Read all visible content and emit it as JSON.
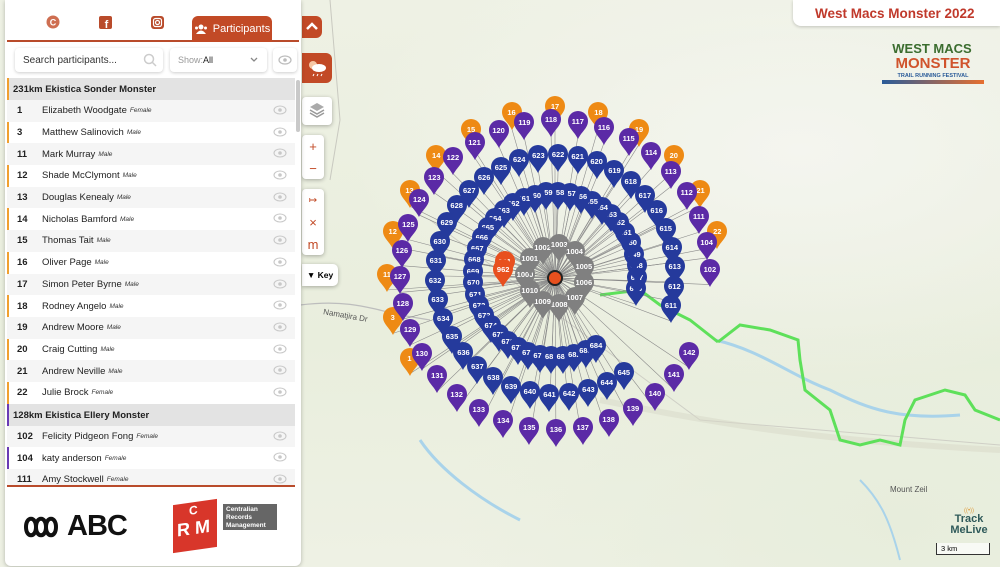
{
  "title": "West Macs Monster 2022",
  "event_logo": {
    "line1": "WEST MACS",
    "line2": "MONSTER",
    "line3": "TRAIL RUNNING FESTIVAL"
  },
  "tabs": {
    "icons": [
      "copyright-icon",
      "facebook-icon",
      "instagram-icon"
    ],
    "active_label": "Participants"
  },
  "filters": {
    "search_placeholder": "Search participants...",
    "show_label": "Show:",
    "show_value": "All"
  },
  "groups": [
    {
      "name": "231km Ekistica Sonder Monster",
      "color": "#f0a030",
      "participants": [
        {
          "num": "1",
          "name": "Elizabeth Woodgate",
          "gender": "Female"
        },
        {
          "num": "3",
          "name": "Matthew Salinovich",
          "gender": "Male"
        },
        {
          "num": "11",
          "name": "Mark Murray",
          "gender": "Male"
        },
        {
          "num": "12",
          "name": "Shade McClymont",
          "gender": "Male"
        },
        {
          "num": "13",
          "name": "Douglas Kenealy",
          "gender": "Male"
        },
        {
          "num": "14",
          "name": "Nicholas Bamford",
          "gender": "Male"
        },
        {
          "num": "15",
          "name": "Thomas Tait",
          "gender": "Male"
        },
        {
          "num": "16",
          "name": "Oliver Page",
          "gender": "Male"
        },
        {
          "num": "17",
          "name": "Simon Peter Byrne",
          "gender": "Male"
        },
        {
          "num": "18",
          "name": "Rodney Angelo",
          "gender": "Male"
        },
        {
          "num": "19",
          "name": "Andrew Moore",
          "gender": "Male"
        },
        {
          "num": "20",
          "name": "Craig Cutting",
          "gender": "Male"
        },
        {
          "num": "21",
          "name": "Andrew Neville",
          "gender": "Male"
        },
        {
          "num": "22",
          "name": "Julie Brock",
          "gender": "Female"
        }
      ]
    },
    {
      "name": "128km Ekistica Ellery Monster",
      "color": "#6a3bb5",
      "participants": [
        {
          "num": "102",
          "name": "Felicity Pidgeon Fong",
          "gender": "Female"
        },
        {
          "num": "104",
          "name": "katy anderson",
          "gender": "Female"
        },
        {
          "num": "111",
          "name": "Amy Stockwell",
          "gender": "Female"
        }
      ]
    }
  ],
  "sponsors": {
    "abc": "ABC",
    "crm": [
      "Centralian",
      "Records",
      "Management"
    ],
    "crm_letters": [
      "C",
      "R",
      "M"
    ]
  },
  "controls": {
    "collapse": "chevron-up",
    "zoom_in": "+",
    "zoom_out": "−",
    "measure": "↦",
    "clear": "×",
    "units": "m",
    "key_label": "▼ Key"
  },
  "map": {
    "labels": {
      "road": "Namatjira Dr",
      "mountain": "Mount Zeil"
    },
    "scale": "3 km",
    "brand": [
      "Track",
      "MeLive"
    ],
    "colors": {
      "orange": "#ee8a14",
      "purple": "#5b2aa6",
      "blue": "#253a9c",
      "grey": "#808080",
      "red": "#e8501e",
      "route": "#5ee05a"
    },
    "markers": {
      "orange": [
        "1",
        "3",
        "11",
        "12",
        "13",
        "14",
        "15",
        "16",
        "17",
        "18",
        "19",
        "20",
        "21",
        "22"
      ],
      "purple": [
        "102",
        "104",
        "111",
        "112",
        "113",
        "114",
        "115",
        "116",
        "117",
        "118",
        "119",
        "120",
        "121",
        "122",
        "123",
        "124",
        "125",
        "126",
        "127",
        "128",
        "129",
        "130",
        "131",
        "132",
        "133",
        "134",
        "135",
        "136",
        "137",
        "138",
        "139",
        "140",
        "141",
        "142"
      ],
      "blue_outer": [
        "611",
        "612",
        "613",
        "614",
        "615",
        "616",
        "617",
        "618",
        "619",
        "620",
        "621",
        "622",
        "623",
        "624",
        "625",
        "626",
        "627",
        "628",
        "629",
        "630",
        "631",
        "632",
        "633",
        "634",
        "635",
        "636",
        "637",
        "638",
        "639",
        "640",
        "641",
        "642",
        "643",
        "644",
        "645"
      ],
      "blue_inner": [
        "646",
        "647",
        "648",
        "649",
        "650",
        "651",
        "652",
        "653",
        "654",
        "655",
        "656",
        "657",
        "658",
        "659",
        "660",
        "661",
        "662",
        "663",
        "664",
        "665",
        "666",
        "667",
        "668",
        "669",
        "670",
        "671",
        "672",
        "673",
        "674",
        "675",
        "676",
        "677",
        "678",
        "679",
        "680",
        "681",
        "682",
        "683",
        "684"
      ],
      "red": [
        "961",
        "962"
      ],
      "grey": [
        "1000",
        "1001",
        "1002",
        "1003",
        "1004",
        "1005",
        "1006",
        "1007",
        "1008",
        "1009",
        "1010"
      ]
    }
  }
}
